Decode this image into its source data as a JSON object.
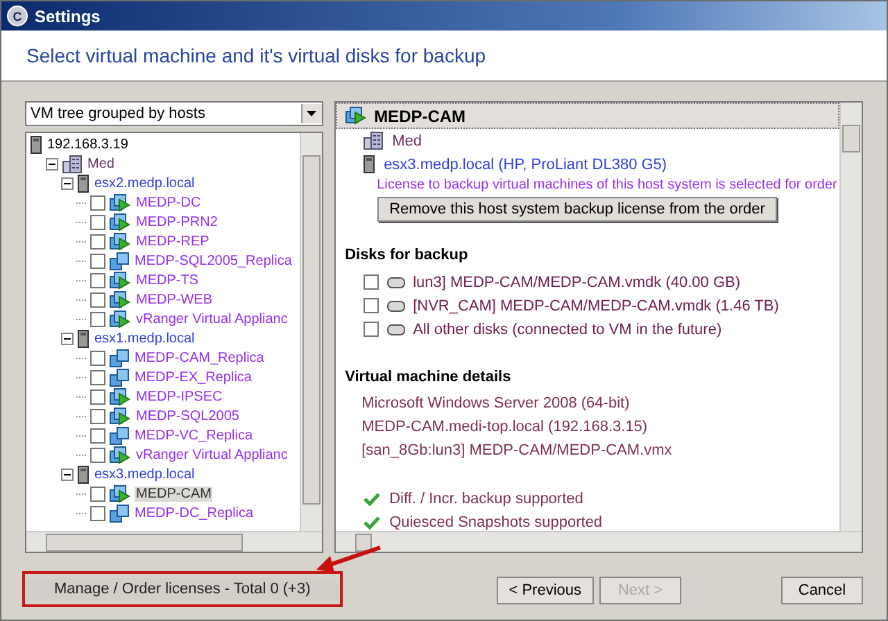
{
  "window": {
    "title": "Settings",
    "icon_letter": "C"
  },
  "heading": "Select virtual machine and it's virtual disks for backup",
  "view_select": {
    "value": "VM tree grouped by hosts"
  },
  "tree": [
    {
      "kind": "server",
      "label": "192.168.3.19",
      "children": [
        {
          "kind": "datacenter",
          "label": "Med",
          "expanded": true,
          "children": [
            {
              "kind": "host",
              "label": "esx2.medp.local",
              "expanded": true,
              "children": [
                {
                  "kind": "vm",
                  "label": "MEDP-DC",
                  "checked": false,
                  "selected": false
                },
                {
                  "kind": "vm",
                  "label": "MEDP-PRN2",
                  "checked": false,
                  "selected": false
                },
                {
                  "kind": "vm",
                  "label": "MEDP-REP",
                  "checked": false,
                  "selected": false
                },
                {
                  "kind": "replica",
                  "label": "MEDP-SQL2005_Replica",
                  "checked": false,
                  "selected": false
                },
                {
                  "kind": "vm",
                  "label": "MEDP-TS",
                  "checked": false,
                  "selected": false
                },
                {
                  "kind": "vm",
                  "label": "MEDP-WEB",
                  "checked": false,
                  "selected": false
                },
                {
                  "kind": "vm",
                  "label": "vRanger Virtual Applianc",
                  "checked": false,
                  "selected": false
                }
              ]
            },
            {
              "kind": "host",
              "label": "esx1.medp.local",
              "expanded": true,
              "children": [
                {
                  "kind": "replica",
                  "label": "MEDP-CAM_Replica",
                  "checked": false,
                  "selected": false
                },
                {
                  "kind": "replica",
                  "label": "MEDP-EX_Replica",
                  "checked": false,
                  "selected": false
                },
                {
                  "kind": "vm",
                  "label": "MEDP-IPSEC",
                  "checked": false,
                  "selected": false
                },
                {
                  "kind": "vm",
                  "label": "MEDP-SQL2005",
                  "checked": false,
                  "selected": false
                },
                {
                  "kind": "replica",
                  "label": "MEDP-VC_Replica",
                  "checked": false,
                  "selected": false
                },
                {
                  "kind": "vm",
                  "label": "vRanger Virtual Applianc",
                  "checked": false,
                  "selected": false
                }
              ]
            },
            {
              "kind": "host",
              "label": "esx3.medp.local",
              "expanded": true,
              "children": [
                {
                  "kind": "vm",
                  "label": "MEDP-CAM",
                  "checked": false,
                  "selected": true
                },
                {
                  "kind": "replica",
                  "label": "MEDP-DC_Replica",
                  "checked": false,
                  "selected": false
                }
              ]
            }
          ]
        }
      ]
    }
  ],
  "details": {
    "title": "MEDP-CAM",
    "datacenter": "Med",
    "host": "esx3.medp.local (HP, ProLiant DL380 G5)",
    "license_note": "License to backup virtual machines of this host system is selected for order",
    "remove_button": "Remove this host system backup license from the order",
    "disks_heading": "Disks for backup",
    "disks": [
      {
        "label": "lun3] MEDP-CAM/MEDP-CAM.vmdk (40.00 GB)",
        "checked": false
      },
      {
        "label": "[NVR_CAM] MEDP-CAM/MEDP-CAM.vmdk (1.46 TB)",
        "checked": false
      },
      {
        "label": "All other disks (connected to VM in the future)",
        "checked": false
      }
    ],
    "vm_heading": "Virtual machine details",
    "vm_lines": [
      "Microsoft Windows Server 2008 (64-bit)",
      "MEDP-CAM.medi-top.local (192.168.3.15)",
      "[san_8Gb:lun3] MEDP-CAM/MEDP-CAM.vmx"
    ],
    "features": [
      {
        "label": "Diff. / Incr. backup supported",
        "supported": true
      },
      {
        "label": "Quiesced Snapshots supported",
        "supported": true
      }
    ]
  },
  "footer": {
    "licenses_button": "Manage / Order licenses - Total 0 (+3)",
    "buttons": [
      {
        "label": "< Previous",
        "disabled": false
      },
      {
        "label": "Next >",
        "disabled": true
      },
      {
        "label": "Cancel",
        "disabled": false
      }
    ]
  }
}
